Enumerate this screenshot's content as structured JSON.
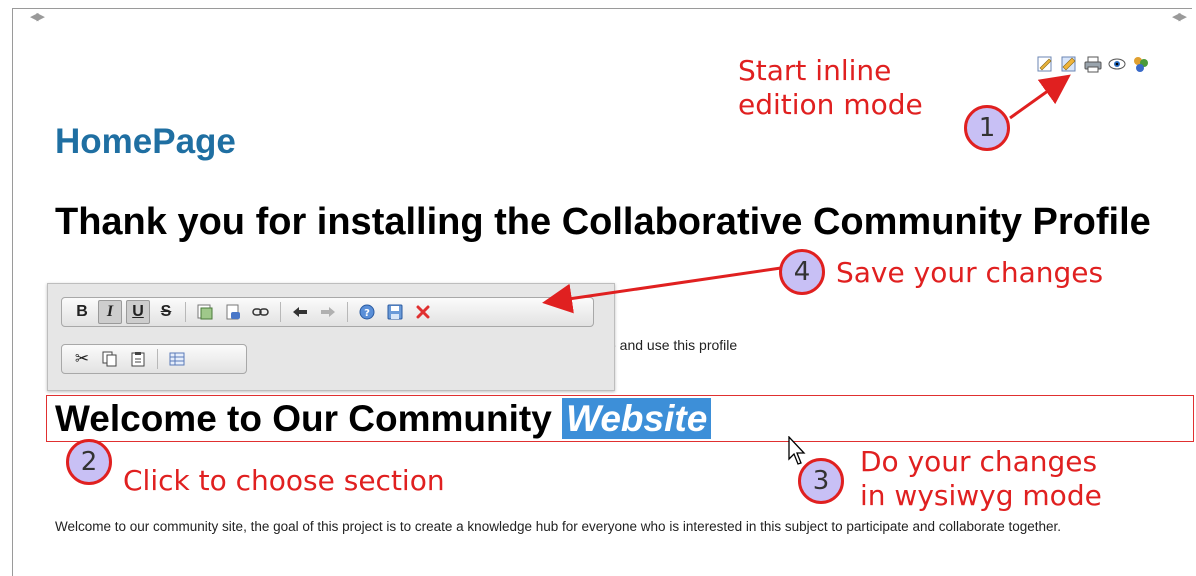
{
  "page": {
    "title": "HomePage",
    "heading": "Thank you for installing the Collaborative Community Profile",
    "body_fragment": "e and use this profile",
    "section_heading": "Welcome to Our Community ",
    "section_highlight": "Website",
    "paragraph": "Welcome to our community site, the goal of this project is to create a knowledge hub for everyone who is interested in this subject to participate and collaborate together."
  },
  "page_icons": [
    "edit-icon",
    "inline-edit-icon",
    "print-icon",
    "watch-icon",
    "plugin-icon"
  ],
  "toolbar": {
    "bold": "B",
    "italic": "I",
    "underline": "U",
    "strike": "S"
  },
  "annotations": {
    "a1_label": "Start inline\nedition mode",
    "a1_num": "1",
    "a2_label": "Click to choose section",
    "a2_num": "2",
    "a3_label": "Do your changes\nin wysiwyg mode",
    "a3_num": "3",
    "a4_label": "Save your changes",
    "a4_num": "4"
  },
  "colors": {
    "title": "#1f6fa2",
    "annotation": "#e02020",
    "highlight": "#3d8fd8",
    "circle_fill": "#c8c0f5"
  }
}
